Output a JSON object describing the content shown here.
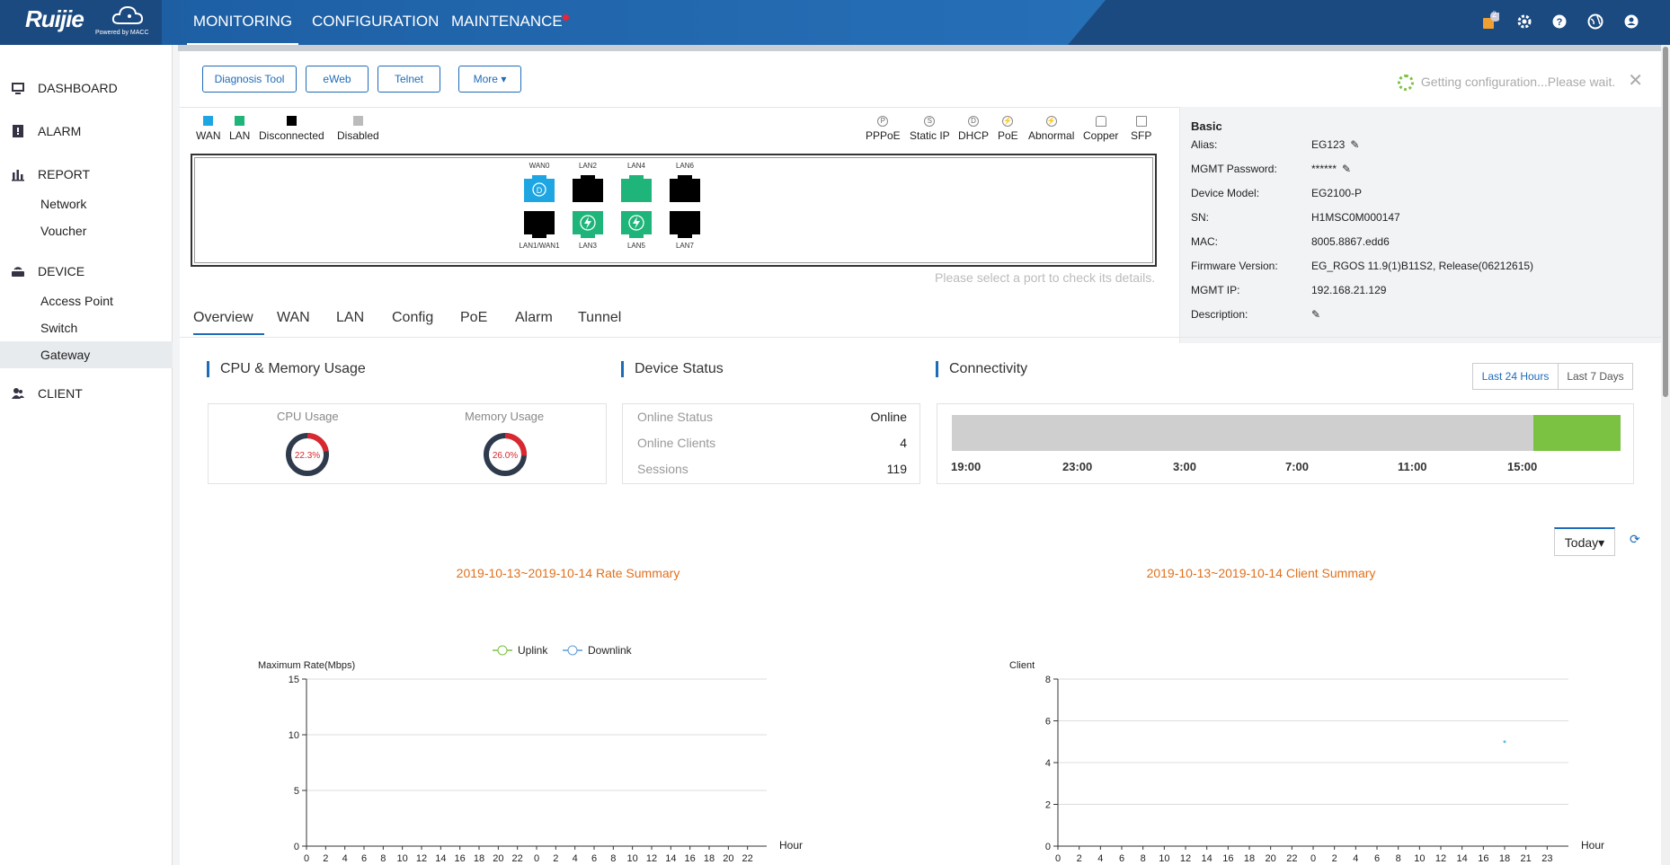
{
  "topbar": {
    "logo": "Ruijie",
    "logo_sub": "Powered by MACC",
    "nav": [
      "MONITORING",
      "CONFIGURATION",
      "MAINTENANCE"
    ],
    "notification_count": "2"
  },
  "sidebar": {
    "items": [
      {
        "label": "DASHBOARD",
        "icon": "monitor-icon"
      },
      {
        "label": "ALARM",
        "icon": "alarm-icon"
      },
      {
        "label": "REPORT",
        "icon": "bar-chart-icon"
      },
      {
        "label": "Network"
      },
      {
        "label": "Voucher"
      },
      {
        "label": "DEVICE",
        "icon": "router-icon"
      },
      {
        "label": "Access Point"
      },
      {
        "label": "Switch"
      },
      {
        "label": "Gateway"
      },
      {
        "label": "CLIENT",
        "icon": "users-icon"
      }
    ]
  },
  "toolbar": {
    "diagnosis": "Diagnosis Tool",
    "eweb": "eWeb",
    "telnet": "Telnet",
    "more": "More",
    "loading_text": "Getting configuration...Please wait."
  },
  "legend": {
    "wan": "WAN",
    "lan": "LAN",
    "disconnected": "Disconnected",
    "disabled": "Disabled",
    "pppoe": "PPPoE",
    "static_ip": "Static IP",
    "dhcp": "DHCP",
    "poe": "PoE",
    "abnormal": "Abnormal",
    "copper": "Copper",
    "sfp": "SFP",
    "colors": {
      "wan": "#1ea6e3",
      "lan": "#1fb57a",
      "disconnected": "#000000",
      "disabled": "#bbbbbb"
    }
  },
  "ports": {
    "top": [
      "WAN0",
      "LAN2",
      "LAN4",
      "LAN6"
    ],
    "bottom": [
      "LAN1/WAN1",
      "LAN3",
      "LAN5",
      "LAN7"
    ],
    "hint": "Please select a port to check its details."
  },
  "basic": {
    "title": "Basic",
    "rows": [
      {
        "k": "Alias:",
        "v": "EG123"
      },
      {
        "k": "MGMT Password:",
        "v": "******"
      },
      {
        "k": "Device Model:",
        "v": "EG2100-P"
      },
      {
        "k": "SN:",
        "v": "H1MSC0M000147"
      },
      {
        "k": "MAC:",
        "v": "8005.8867.edd6"
      },
      {
        "k": "Firmware Version:",
        "v": "EG_RGOS 11.9(1)B11S2, Release(06212615)"
      },
      {
        "k": "MGMT IP:",
        "v": "192.168.21.129"
      },
      {
        "k": "Description:",
        "v": ""
      }
    ]
  },
  "tabs": [
    "Overview",
    "WAN",
    "LAN",
    "Config",
    "PoE",
    "Alarm",
    "Tunnel"
  ],
  "cpu_mem": {
    "title": "CPU & Memory Usage",
    "cpu_label": "CPU Usage",
    "cpu_value": "22.3%",
    "cpu_fraction": 0.223,
    "mem_label": "Memory Usage",
    "mem_value": "26.0%",
    "mem_fraction": 0.26
  },
  "device_status": {
    "title": "Device Status",
    "rows": [
      {
        "k": "Online Status",
        "v": "Online"
      },
      {
        "k": "Online Clients",
        "v": "4"
      },
      {
        "k": "Sessions",
        "v": "119"
      }
    ]
  },
  "connectivity": {
    "title": "Connectivity",
    "last24": "Last 24 Hours",
    "last7": "Last 7 Days",
    "times": [
      "19:00",
      "23:00",
      "3:00",
      "7:00",
      "11:00",
      "15:00"
    ],
    "online_fraction": 0.13
  },
  "period": {
    "label": "Today"
  },
  "chart_data": [
    {
      "type": "line",
      "title": "2019-10-13~2019-10-14 Rate Summary",
      "ylabel": "Maximum Rate(Mbps)",
      "xlabel": "Hour",
      "x": [
        "0",
        "2",
        "4",
        "6",
        "8",
        "10",
        "12",
        "14",
        "16",
        "18",
        "20",
        "22",
        "0",
        "2",
        "4",
        "6",
        "8",
        "10",
        "12",
        "14",
        "16",
        "18",
        "20",
        "22"
      ],
      "ylim": [
        0,
        15
      ],
      "yticks": [
        0,
        5,
        10,
        15
      ],
      "series": [
        {
          "name": "Uplink",
          "color": "#7bc142",
          "values": []
        },
        {
          "name": "Downlink",
          "color": "#5b9bd5",
          "values": []
        }
      ],
      "grid": true
    },
    {
      "type": "scatter",
      "title": "2019-10-13~2019-10-14 Client Summary",
      "ylabel": "Client",
      "xlabel": "Hour",
      "x": [
        "0",
        "2",
        "4",
        "6",
        "8",
        "10",
        "12",
        "14",
        "16",
        "18",
        "20",
        "22",
        "0",
        "2",
        "4",
        "6",
        "8",
        "10",
        "12",
        "14",
        "16",
        "18",
        "21",
        "23"
      ],
      "ylim": [
        0,
        8
      ],
      "yticks": [
        0,
        2,
        4,
        6,
        8
      ],
      "series": [
        {
          "color": "#5bc0de",
          "points": [
            {
              "xi": 21,
              "y": 5
            }
          ]
        }
      ],
      "grid": true
    }
  ]
}
